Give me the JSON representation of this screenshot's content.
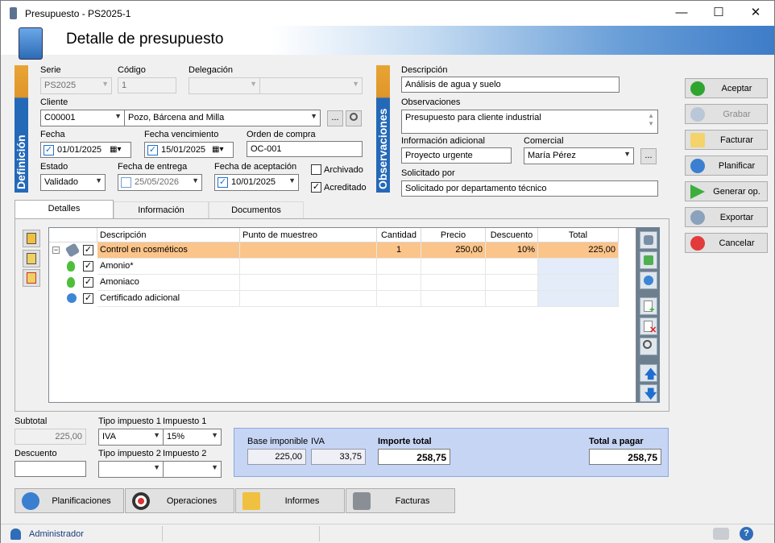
{
  "window": {
    "title": "Presupuesto - PS2025-1",
    "minimize": "—",
    "maximize": "☐",
    "close": "✕"
  },
  "header": {
    "title": "Detalle de presupuesto"
  },
  "side_tabs": {
    "definition": "Definición",
    "observations": "Observaciones"
  },
  "form": {
    "serie_label": "Serie",
    "serie_value": "PS2025",
    "codigo_label": "Código",
    "codigo_value": "1",
    "delegacion_label": "Delegación",
    "cliente_label": "Cliente",
    "cliente_code": "C00001",
    "cliente_name": "Pozo, Bárcena and Milla",
    "fecha_label": "Fecha",
    "fecha_value": "01/01/2025",
    "fecha_venc_label": "Fecha vencimiento",
    "fecha_venc_value": "15/01/2025",
    "orden_label": "Orden de compra",
    "orden_value": "OC-001",
    "estado_label": "Estado",
    "estado_value": "Validado",
    "fecha_entrega_label": "Fecha de entrega",
    "fecha_entrega_value": "25/05/2026",
    "fecha_acept_label": "Fecha de aceptación",
    "fecha_acept_value": "10/01/2025",
    "archivado_label": "Archivado",
    "acreditado_label": "Acreditado",
    "descripcion_label": "Descripción",
    "descripcion_value": "Análisis de agua y suelo",
    "observaciones_label": "Observaciones",
    "observaciones_value": "Presupuesto para cliente industrial",
    "info_label": "Información adicional",
    "info_value": "Proyecto urgente",
    "comercial_label": "Comercial",
    "comercial_value": "María Pérez",
    "solicitado_label": "Solicitado por",
    "solicitado_value": "Solicitado por departamento técnico",
    "ellipsis": "..."
  },
  "actions": [
    "Aceptar",
    "Grabar",
    "Facturar",
    "Planificar",
    "Generar op.",
    "Exportar",
    "Cancelar"
  ],
  "tabs": [
    "Detalles",
    "Información",
    "Documentos"
  ],
  "grid": {
    "columns": [
      "Descripción",
      "Punto de muestreo",
      "Cantidad",
      "Precio",
      "Descuento",
      "Total"
    ],
    "rows": [
      {
        "desc": "Control en cosméticos",
        "punto": "",
        "cantidad": "1",
        "precio": "250,00",
        "descuento": "10%",
        "total": "225,00",
        "expand": "−"
      },
      {
        "desc": "Amonio*",
        "punto": "",
        "cantidad": "",
        "precio": "",
        "descuento": "",
        "total": ""
      },
      {
        "desc": "Amoniaco",
        "punto": "",
        "cantidad": "",
        "precio": "",
        "descuento": "",
        "total": ""
      },
      {
        "desc": "Certificado adicional",
        "punto": "",
        "cantidad": "",
        "precio": "",
        "descuento": "",
        "total": ""
      }
    ]
  },
  "summary": {
    "subtotal_label": "Subtotal",
    "subtotal_value": "225,00",
    "descuento_label": "Descuento",
    "descuento_value": "",
    "tipo1_label": "Tipo impuesto 1",
    "tipo1_value": "IVA",
    "imp1_label": "Impuesto 1",
    "imp1_value": "15%",
    "tipo2_label": "Tipo impuesto 2",
    "imp2_label": "Impuesto 2",
    "base_label": "Base imponible",
    "base_value": "225,00",
    "iva_label": "IVA",
    "iva_value": "33,75",
    "importe_label": "Importe total",
    "importe_value": "258,75",
    "pagar_label": "Total a pagar",
    "pagar_value": "258,75"
  },
  "bottom_buttons": [
    "Planificaciones",
    "Operaciones",
    "Informes",
    "Facturas"
  ],
  "status": {
    "user": "Administrador"
  }
}
